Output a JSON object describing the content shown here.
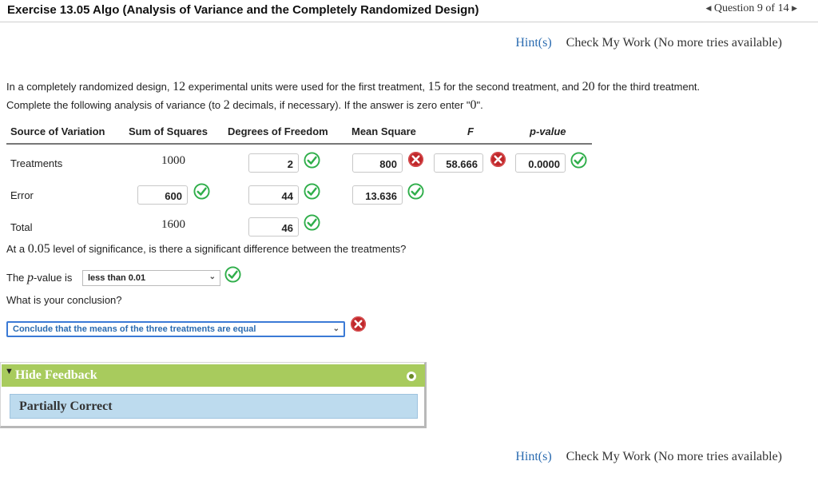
{
  "header": {
    "title": "Exercise 13.05 Algo (Analysis of Variance and the Completely Randomized Design)",
    "question_nav": "Question 9 of 14"
  },
  "links": {
    "hint": "Hint(s)",
    "check": "Check My Work (No more tries available)"
  },
  "question": {
    "line1_a": "In a completely randomized design, ",
    "n1": "12",
    "line1_b": " experimental units were used for the first treatment, ",
    "n2": "15",
    "line1_c": " for the second treatment, and ",
    "n3": "20",
    "line1_d": " for the third treatment.",
    "line2_a": "Complete the following analysis of variance (to ",
    "decimals": "2",
    "line2_b": " decimals, if necessary). If the answer is zero enter \"",
    "zero": "0",
    "line2_c": "\"."
  },
  "table": {
    "headers": [
      "Source of Variation",
      "Sum of Squares",
      "Degrees of Freedom",
      "Mean Square",
      "F",
      "p-value"
    ],
    "treatments": {
      "label": "Treatments",
      "ss": "1000",
      "df": "2",
      "ms": "800",
      "f": "58.666",
      "p": "0.0000"
    },
    "error": {
      "label": "Error",
      "ss": "600",
      "df": "44",
      "ms": "13.636"
    },
    "total": {
      "label": "Total",
      "ss": "1600",
      "df": "46"
    }
  },
  "significance": {
    "text_a": "At a ",
    "alpha": "0.05",
    "text_b": " level of significance, is there a significant difference between the treatments?"
  },
  "pvalue_q": {
    "text_a": "The ",
    "p": "p",
    "text_b": "-value is",
    "selected": "less than 0.01"
  },
  "conclusion": {
    "question": "What is your conclusion?",
    "selected": "Conclude that the means of the three treatments are equal"
  },
  "feedback": {
    "toggle": "Hide Feedback",
    "result": "Partially Correct"
  },
  "colors": {
    "correct": "#2fae4a",
    "incorrect": "#c0282b",
    "feedback_bar": "#a8cb5d",
    "feedback_body": "#bddbee"
  }
}
